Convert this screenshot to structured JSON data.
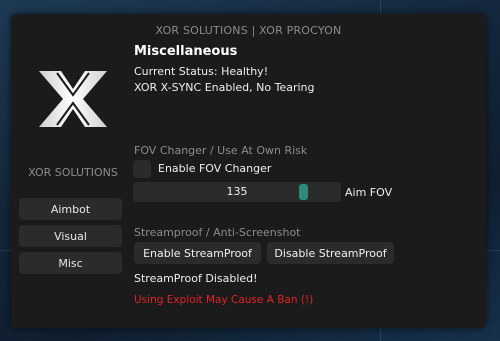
{
  "window": {
    "title": "XOR SOLUTIONS | XOR PROCYON"
  },
  "sidebar": {
    "logo_icon": "xor-x-logo",
    "brand": "XOR SOLUTIONS",
    "items": [
      {
        "label": "Aimbot"
      },
      {
        "label": "Visual"
      },
      {
        "label": "Misc"
      }
    ]
  },
  "main": {
    "heading": "Miscellaneous",
    "status_line": "Current Status:  Healthy!",
    "sync_line": "XOR X-SYNC Enabled, No Tearing",
    "fov": {
      "section": "FOV Changer / Use At Own Risk",
      "checkbox_label": "Enable FOV Changer",
      "checked": false,
      "value": "135",
      "level": 0.84,
      "label": "Aim FOV"
    },
    "streamproof": {
      "section": "Streamproof / Anti-Screenshot",
      "enable_label": "Enable StreamProof",
      "disable_label": "Disable StreamProof",
      "status": "StreamProof Disabled!"
    },
    "warning": "Using Exploit May Cause A Ban (!)"
  },
  "colors": {
    "accent": "#2f8a7f",
    "warning": "#e12222",
    "panel": "#1b1b1b",
    "control": "#2b2b2b"
  }
}
